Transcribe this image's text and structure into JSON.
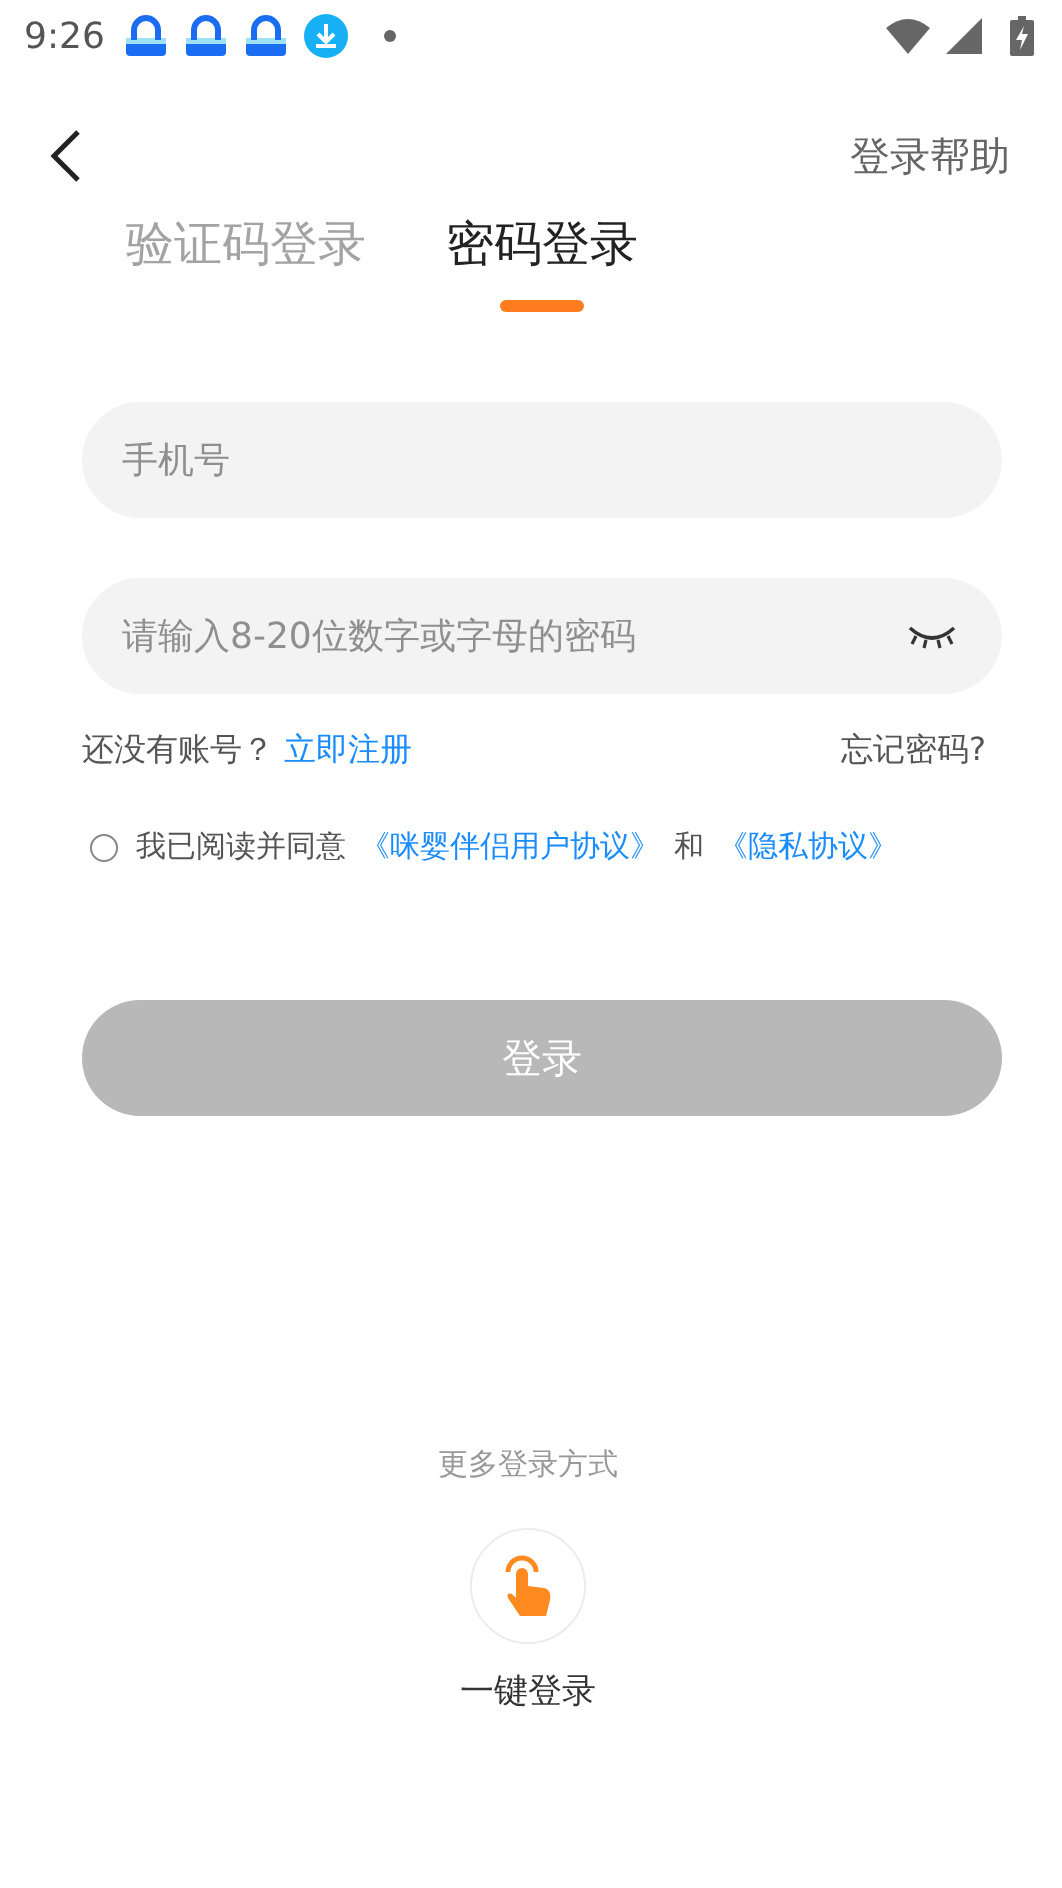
{
  "status_bar": {
    "time": "9:26"
  },
  "header": {
    "help_link": "登录帮助"
  },
  "tabs": [
    {
      "label": "验证码登录",
      "selected": false
    },
    {
      "label": "密码登录",
      "selected": true
    }
  ],
  "fields": [
    {
      "kind": "phone",
      "placeholder": "手机号"
    },
    {
      "kind": "password",
      "placeholder": "请输入8-20位数字或字母的密码"
    }
  ],
  "register_row": {
    "prompt": "还没有账号？",
    "register_link": "立即注册",
    "forgot_link": "忘记密码?"
  },
  "agreement": {
    "checked": false,
    "text": "我已阅读并同意",
    "user_agreement": "《咪婴伴侣用户协议》",
    "conjunction": "和",
    "privacy_policy": "《隐私协议》"
  },
  "login_button": {
    "label": "登录",
    "disabled": true
  },
  "more_login": {
    "title": "更多登录方式",
    "one_tap_label": "一键登录"
  }
}
